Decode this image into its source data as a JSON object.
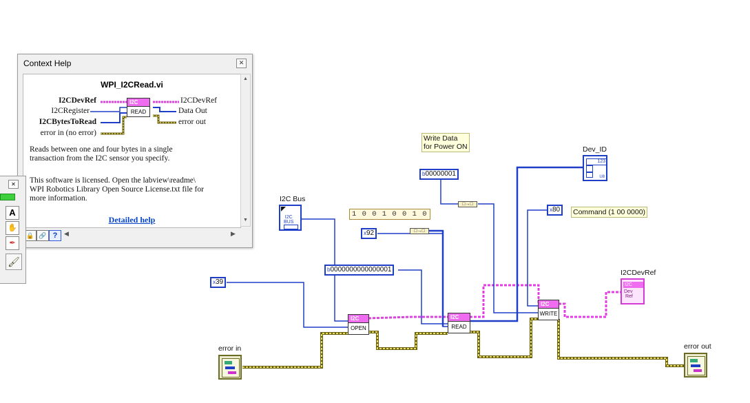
{
  "context_help": {
    "title": "Context Help",
    "vi_name": "WPI_I2CRead.vi",
    "inputs": [
      "I2CDevRef",
      "I2CRegister",
      "I2CBytesToRead",
      "error in (no error)"
    ],
    "outputs": [
      "I2CDevRef",
      "Data Out",
      "error out"
    ],
    "node_badge": "I2C",
    "node_label": "READ",
    "description_1": "Reads between one and four bytes in a single\ntransaction from the I2C sensor you specify.",
    "description_2": "This software is licensed. Open the labview\\readme\\\nWPI Robotics Library Open Source License.txt file for\nmore information.",
    "detailed_help": "Detailed help"
  },
  "diagram": {
    "i2c_bus_label": "I2C Bus",
    "bus_icon_text": "I2C\nBUS",
    "write_note": "Write Data\nfor Power ON",
    "bits_const": "1 0 0 1 0 0 1 0",
    "const_0x92": "92",
    "const_0x39": "39",
    "const_0x80": "80",
    "const_bin1": "00000001",
    "const_bin16": "0000000000000001",
    "command_note": "Command (1 00 0000)",
    "dev_id_label": "Dev_ID",
    "dev_id_icon": "123",
    "dev_id_type": "U8",
    "i2cdevref_label": "I2CDevRef",
    "error_in_label": "error in",
    "error_out_label": "error out",
    "open_label": "OPEN",
    "read_label": "READ",
    "write_label": "WRITE",
    "badge": "I2C",
    "hex_prefix": "x",
    "bin_prefix": "b"
  },
  "colors": {
    "devref_wire": "#e23fe2",
    "numeric_wire": "#1f3ec7",
    "error_wire": "#a89a24"
  }
}
